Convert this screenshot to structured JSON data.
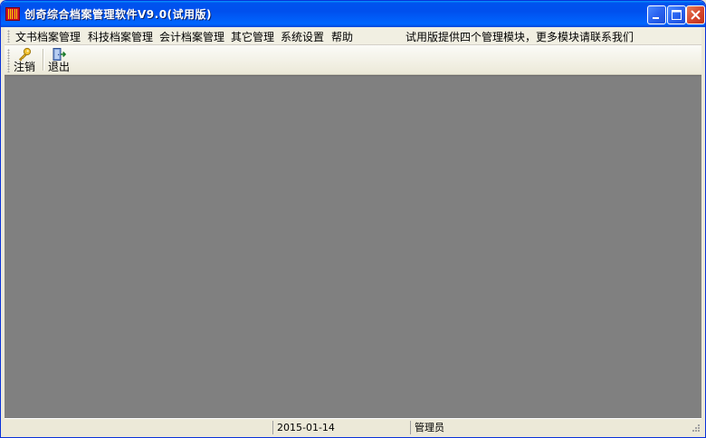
{
  "window": {
    "title": "创奇综合档案管理软件V9.0(试用版)"
  },
  "menu": {
    "items": [
      "文书档案管理",
      "科技档案管理",
      "会计档案管理",
      "其它管理",
      "系统设置",
      "帮助"
    ],
    "notice": "试用版提供四个管理模块，更多模块请联系我们"
  },
  "toolbar": {
    "logout_label": "注销",
    "exit_label": "退出"
  },
  "status": {
    "date": "2015-01-14",
    "user": "管理员"
  },
  "colors": {
    "titlebar": "#0054e3",
    "workspace": "#808080",
    "chrome": "#ece9d8"
  },
  "icons": [
    "app-icon",
    "key-icon",
    "exit-door-icon",
    "minimize-icon",
    "maximize-icon",
    "close-icon"
  ]
}
